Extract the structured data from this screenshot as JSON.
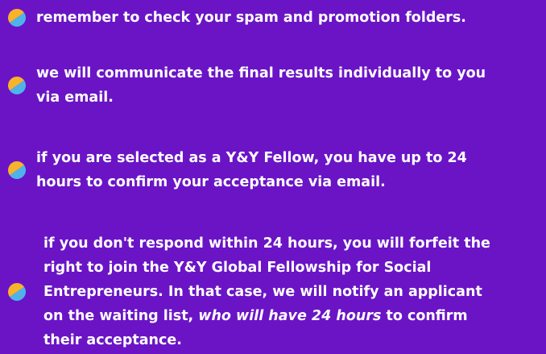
{
  "items": [
    {
      "lines": [
        "remember to check your spam and promotion folders."
      ]
    },
    {
      "lines": [
        "we will communicate the final results individually to you",
        "via email."
      ]
    },
    {
      "lines": [
        "if you are selected as a Y&Y Fellow, you have up to 24",
        "hours to confirm your acceptance via email."
      ]
    },
    {
      "line1": "if you don't respond within 24 hours, you will forfeit the",
      "line2": "right to join the Y&Y Global Fellowship for Social",
      "line3": "Entrepreneurs. In that case, we will notify an applicant",
      "line4_pre": "on the waiting list, ",
      "line4_em": "who will have 24 hours",
      "line4_post": " to confirm",
      "line5": "their acceptance."
    }
  ],
  "colors": {
    "background": "#6a14c6",
    "text": "#ffffff",
    "bullet_top": "#f7b32b",
    "bullet_bottom": "#4fb3ea"
  },
  "icons": {
    "bullet": "half-moon-bullet-icon"
  }
}
